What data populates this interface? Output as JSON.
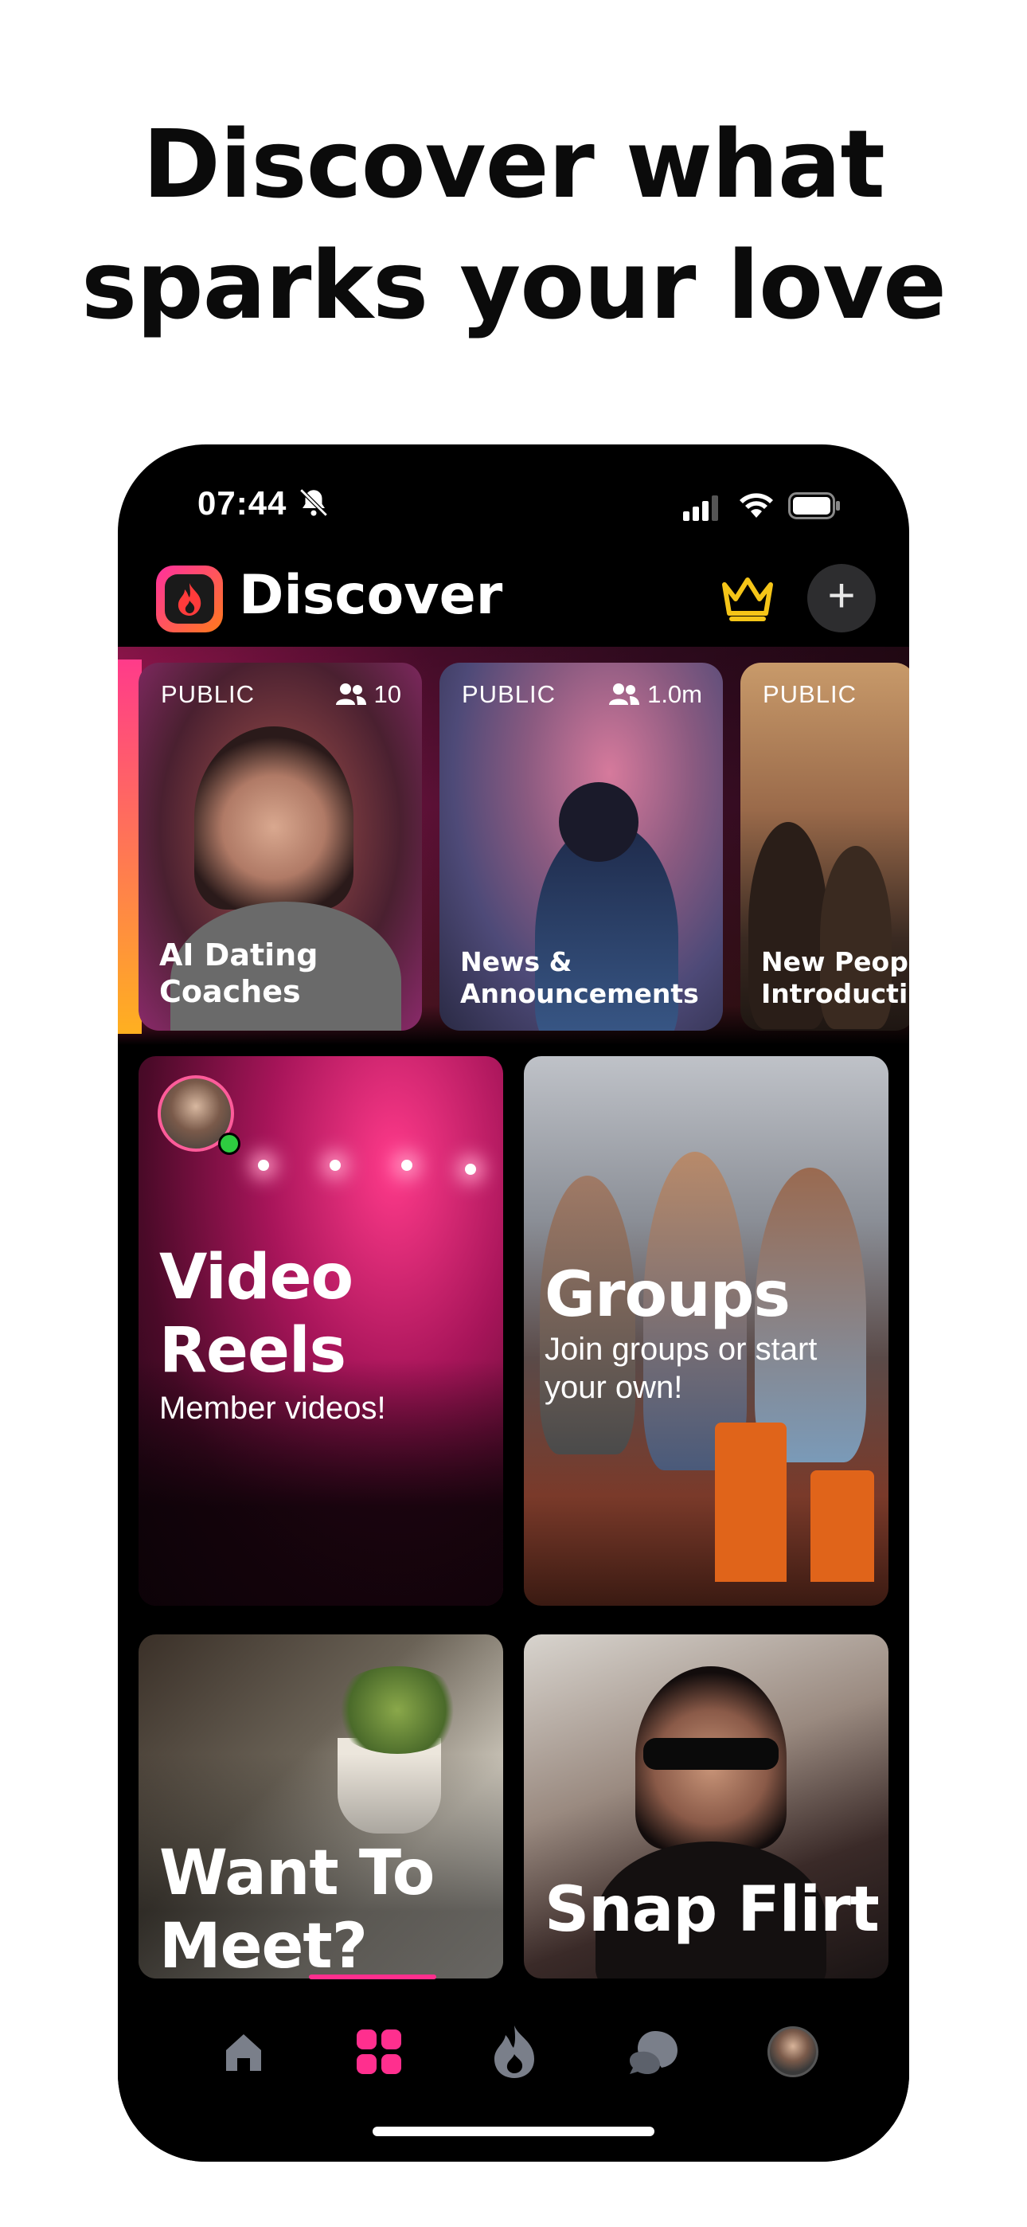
{
  "headline": {
    "line1": "Discover what",
    "line2": "sparks your love"
  },
  "status_bar": {
    "time": "07:44"
  },
  "header": {
    "title": "Discover"
  },
  "channels": [
    {
      "visibility": "PUBLIC",
      "members": "10",
      "label_line1": "AI Dating",
      "label_line2": "Coaches"
    },
    {
      "visibility": "PUBLIC",
      "members": "1.0m",
      "label_line1": "News &",
      "label_line2": "Announcements"
    },
    {
      "visibility": "PUBLIC",
      "members": "",
      "label_line1": "New Peopl",
      "label_line2": "Introducti"
    }
  ],
  "tiles": {
    "video": {
      "title_line1": "Video",
      "title_line2": "Reels",
      "subtitle": "Member videos!"
    },
    "groups": {
      "title": "Groups",
      "subtitle_line1": "Join groups or start",
      "subtitle_line2": "your own!"
    },
    "meet": {
      "title_line1": "Want To",
      "title_line2": "Meet?"
    },
    "snap": {
      "title": "Snap Flirt"
    }
  },
  "tabs": [
    {
      "icon": "home-icon",
      "active": false
    },
    {
      "icon": "grid-icon",
      "active": true
    },
    {
      "icon": "flame-icon",
      "active": false
    },
    {
      "icon": "chat-icon",
      "active": false
    },
    {
      "icon": "profile-avatar",
      "active": false
    }
  ],
  "colors": {
    "accent": "#ff2f8e",
    "crown": "#f5c518",
    "background": "#000000"
  }
}
